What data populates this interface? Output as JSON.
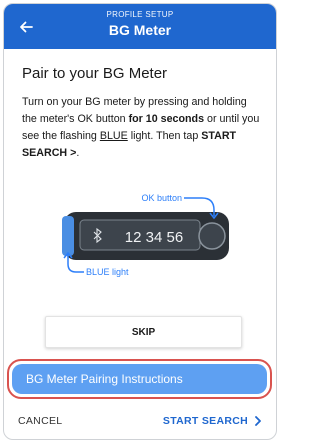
{
  "header": {
    "supertitle": "PROFILE SETUP",
    "title": "BG Meter",
    "bg_color": "#1f67cf"
  },
  "main": {
    "heading": "Pair to your BG Meter",
    "desc_part1": "Turn on your BG meter by pressing and holding the meter's OK button ",
    "desc_bold1": "for 10 seconds",
    "desc_part2": " or until you see the flashing ",
    "desc_underline": "BLUE",
    "desc_part3": " light. Then tap ",
    "desc_bold2": "START SEARCH >",
    "desc_part4": "."
  },
  "illustration": {
    "ok_label": "OK button",
    "blue_label": "BLUE light",
    "display_text": "12 34 56",
    "callout_color": "#2d7ff9"
  },
  "buttons": {
    "skip": "SKIP",
    "pairing_instructions": "BG Meter Pairing Instructions",
    "cancel": "CANCEL",
    "start_search": "START SEARCH"
  },
  "icons": {
    "back": "arrow-left-icon",
    "bluetooth": "bluetooth-icon",
    "chevron": "chevron-right-icon"
  }
}
